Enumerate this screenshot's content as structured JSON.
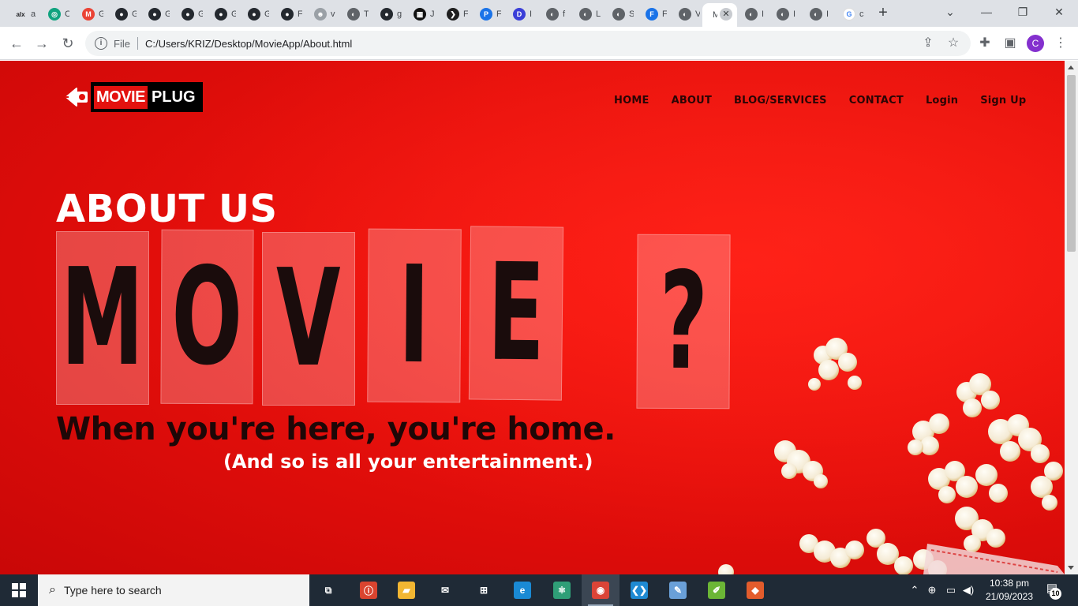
{
  "browser": {
    "tabs": [
      {
        "icon": "alx-icon",
        "label": "a",
        "color": "#202124",
        "glyph": "alx"
      },
      {
        "icon": "chatgpt-icon",
        "label": "C",
        "color": "#10a37f",
        "glyph": "◎"
      },
      {
        "icon": "gmail-icon",
        "label": "G",
        "color": "#ea4335",
        "glyph": "M"
      },
      {
        "icon": "github-icon",
        "label": "G",
        "color": "#24292f",
        "glyph": "●"
      },
      {
        "icon": "github-icon",
        "label": "G",
        "color": "#24292f",
        "glyph": "●"
      },
      {
        "icon": "github-icon",
        "label": "G",
        "color": "#24292f",
        "glyph": "●"
      },
      {
        "icon": "github-icon",
        "label": "G",
        "color": "#24292f",
        "glyph": "●"
      },
      {
        "icon": "github-icon",
        "label": "G",
        "color": "#24292f",
        "glyph": "●"
      },
      {
        "icon": "github-icon",
        "label": "F",
        "color": "#24292f",
        "glyph": "●"
      },
      {
        "icon": "robot-icon",
        "label": "v",
        "color": "#9aa0a6",
        "glyph": "☻"
      },
      {
        "icon": "globe-icon",
        "label": "T",
        "color": "#5f6368",
        "glyph": "◐"
      },
      {
        "icon": "github-icon",
        "label": "g",
        "color": "#24292f",
        "glyph": "●"
      },
      {
        "icon": "film-icon",
        "label": "J",
        "color": "#111111",
        "glyph": "▦"
      },
      {
        "icon": "plex-icon",
        "label": "F",
        "color": "#1f1f1f",
        "glyph": "❯"
      },
      {
        "icon": "p-icon",
        "label": "F",
        "color": "#1a73e8",
        "glyph": "P"
      },
      {
        "icon": "d-icon",
        "label": "I",
        "color": "#3b3fd8",
        "glyph": "D"
      },
      {
        "icon": "globe-icon",
        "label": "f",
        "color": "#5f6368",
        "glyph": "◐"
      },
      {
        "icon": "globe-icon",
        "label": "L",
        "color": "#5f6368",
        "glyph": "◐"
      },
      {
        "icon": "globe-icon",
        "label": "S",
        "color": "#5f6368",
        "glyph": "◐"
      },
      {
        "icon": "forms-icon",
        "label": "F",
        "color": "#1a73e8",
        "glyph": "F"
      },
      {
        "icon": "globe-icon",
        "label": "V",
        "color": "#5f6368",
        "glyph": "◐"
      },
      {
        "icon": "movie-tab",
        "label": "M",
        "color": "#ffffff",
        "glyph": "",
        "active": true
      },
      {
        "icon": "globe-icon",
        "label": "I",
        "color": "#5f6368",
        "glyph": "◐"
      },
      {
        "icon": "globe-icon",
        "label": "I",
        "color": "#5f6368",
        "glyph": "◐"
      },
      {
        "icon": "globe-icon",
        "label": "I",
        "color": "#5f6368",
        "glyph": "◐"
      },
      {
        "icon": "google-icon",
        "label": "c",
        "color": "#ffffff",
        "glyph": "G"
      }
    ],
    "new_tab": "+",
    "address": {
      "scheme": "File",
      "url": "C:/Users/KRIZ/Desktop/MovieApp/About.html"
    },
    "profile_initial": "C"
  },
  "site": {
    "logo": {
      "word1": "MOVIE",
      "word2": "PLUG"
    },
    "nav": [
      "HOME",
      "ABOUT",
      "BLOG/SERVICES",
      "CONTACT",
      "Login",
      "Sign Up"
    ],
    "hero": {
      "heading": "ABOUT US",
      "letters": [
        "M",
        "O",
        "V",
        "I",
        "E",
        "?"
      ],
      "tagline": "When you're here, you're home.",
      "subtagline": "(And so is all your entertainment.)"
    }
  },
  "taskbar": {
    "search_placeholder": "Type here to search",
    "apps": [
      {
        "name": "task-view-icon",
        "glyph": "⧉",
        "color": "#1f2a36"
      },
      {
        "name": "app-red-icon",
        "glyph": "ⓘ",
        "color": "#d9442f"
      },
      {
        "name": "file-explorer-icon",
        "glyph": "▰",
        "color": "#f2b632"
      },
      {
        "name": "mail-icon",
        "glyph": "✉",
        "color": "#1f2a36"
      },
      {
        "name": "store-icon",
        "glyph": "⊞",
        "color": "#1f2a36"
      },
      {
        "name": "edge-icon",
        "glyph": "e",
        "color": "#1a8ad4"
      },
      {
        "name": "electron-icon",
        "glyph": "⚛",
        "color": "#2f9e77"
      },
      {
        "name": "chrome-icon",
        "glyph": "◉",
        "color": "#db4437",
        "active": true
      },
      {
        "name": "vscode-icon",
        "glyph": "❮❯",
        "color": "#1f8ad2"
      },
      {
        "name": "paint-icon",
        "glyph": "✎",
        "color": "#6aa0d8"
      },
      {
        "name": "notepadpp-icon",
        "glyph": "✐",
        "color": "#6bb636"
      },
      {
        "name": "git-icon",
        "glyph": "◆",
        "color": "#e35c2c"
      }
    ],
    "time": "10:38 pm",
    "date": "21/09/2023",
    "notifications": "10"
  }
}
